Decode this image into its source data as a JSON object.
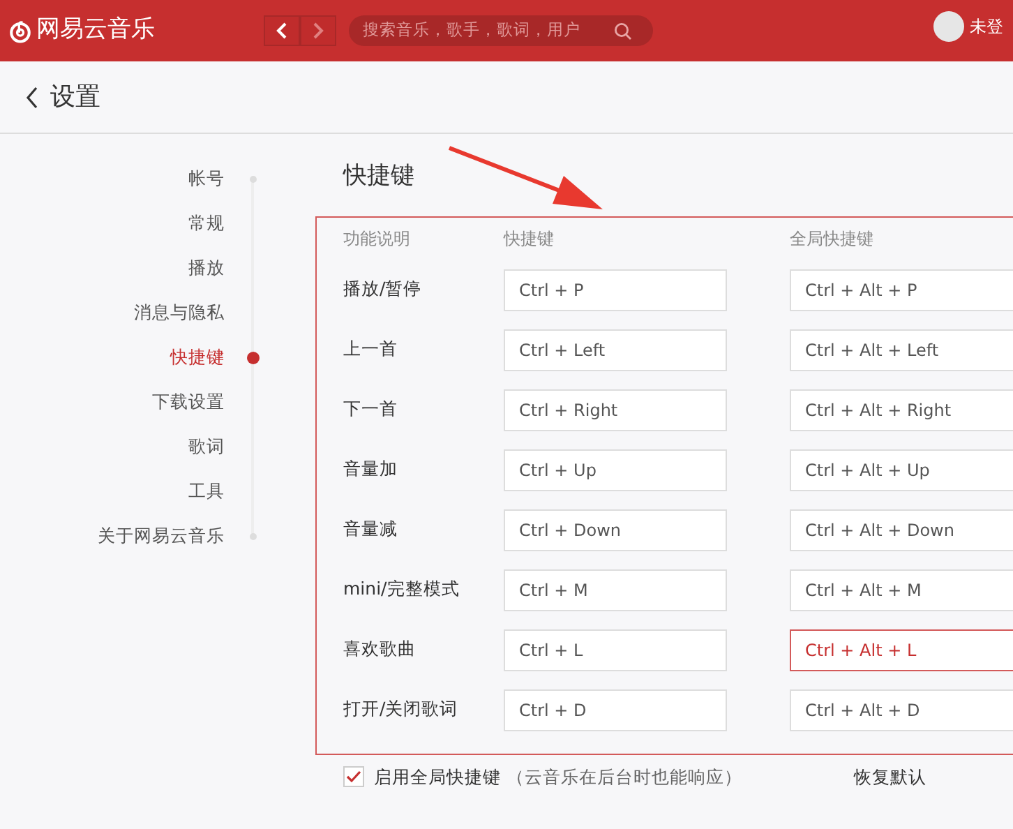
{
  "header": {
    "logo": "网易云音乐",
    "search": {
      "placeholder": "搜索音乐，歌手，歌词，用户"
    },
    "back_disabled": false,
    "forward_disabled": true,
    "user": "未登"
  },
  "page": {
    "title": "设置"
  },
  "sidebar": {
    "items": [
      {
        "label": "帐号",
        "selected": false
      },
      {
        "label": "常规",
        "selected": false
      },
      {
        "label": "播放",
        "selected": false
      },
      {
        "label": "消息与隐私",
        "selected": false
      },
      {
        "label": "快捷键",
        "selected": true
      },
      {
        "label": "下载设置",
        "selected": false
      },
      {
        "label": "歌词",
        "selected": false
      },
      {
        "label": "工具",
        "selected": false
      },
      {
        "label": "关于网易云音乐",
        "selected": false
      }
    ]
  },
  "section": {
    "title": "快捷键",
    "columns": [
      "功能说明",
      "快捷键",
      "全局快捷键"
    ],
    "rows": [
      {
        "name": "播放/暂停",
        "local": "Ctrl + P",
        "global": "Ctrl + Alt + P",
        "focused": false
      },
      {
        "name": "上一首",
        "local": "Ctrl + Left",
        "global": "Ctrl + Alt + Left",
        "focused": false
      },
      {
        "name": "下一首",
        "local": "Ctrl + Right",
        "global": "Ctrl + Alt + Right",
        "focused": false
      },
      {
        "name": "音量加",
        "local": "Ctrl + Up",
        "global": "Ctrl + Alt + Up",
        "focused": false
      },
      {
        "name": "音量减",
        "local": "Ctrl + Down",
        "global": "Ctrl + Alt + Down",
        "focused": false
      },
      {
        "name": "mini/完整模式",
        "local": "Ctrl + M",
        "global": "Ctrl + Alt + M",
        "focused": false
      },
      {
        "name": "喜欢歌曲",
        "local": "Ctrl + L",
        "global": "Ctrl + Alt + L",
        "focused": true
      },
      {
        "name": "打开/关闭歌词",
        "local": "Ctrl + D",
        "global": "Ctrl + Alt + D",
        "focused": false
      }
    ],
    "global_enabled": {
      "label": "启用全局快捷键",
      "note": "（云音乐在后台时也能响应）",
      "checked": true
    },
    "reset": "恢复默认"
  }
}
